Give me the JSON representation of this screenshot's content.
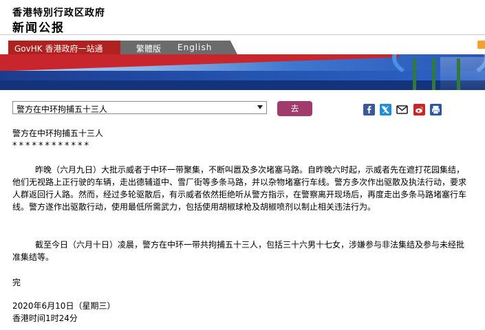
{
  "header": {
    "site_title": "香港特別行政区政府",
    "site_subtitle": "新闻公报"
  },
  "tabs": {
    "govhk": "GovHK 香港政府一站通",
    "traditional": "繁體版",
    "english": "English"
  },
  "toolbar": {
    "select_value": "警方在中环拘捕五十三人",
    "go_label": "去",
    "share_icons": [
      "facebook-icon",
      "twitter-icon",
      "email-icon",
      "mobile-icon",
      "weibo-icon",
      "print-icon"
    ]
  },
  "article": {
    "title": "警方在中环拘捕五十三人",
    "stars": "************",
    "paragraph1": "昨晚（六月九日）大批示威者于中环一带聚集，不断叫嚣及多次堵塞马路。自昨晚六时起，示威者先在遮打花园集结，他们无视路上正行驶的车辆，走出德辅道中、雪厂街等多条马路，并以杂物堵塞行车线。警方多次作出驱散及执法行动，要求人群返回行人路。然而，经过多轮驱散后，有示威者依然拒绝听从警方指示，在警察离开现场后，再度走出多条马路堵塞行车线。警方遂作出驱散行动，使用最低所需武力，包括使用胡椒球枪及胡椒喷剂以制止相关违法行为。",
    "paragraph2": "截至今日（六月十日）凌晨，警方在中环一带共拘捕五十三人，包括三十六男十七女，涉嫌参与非法集结及参与未经批准集结等。",
    "end_mark": "完",
    "date": "2020年6月10日（星期三）",
    "time": "香港时间1时24分"
  },
  "colors": {
    "govhk_tab": "#b0221f",
    "go_button": "#a03b6b",
    "facebook": "#3b5998",
    "twitter": "#1d8fd8",
    "weibo": "#c8262c",
    "print": "#2d56a8"
  }
}
